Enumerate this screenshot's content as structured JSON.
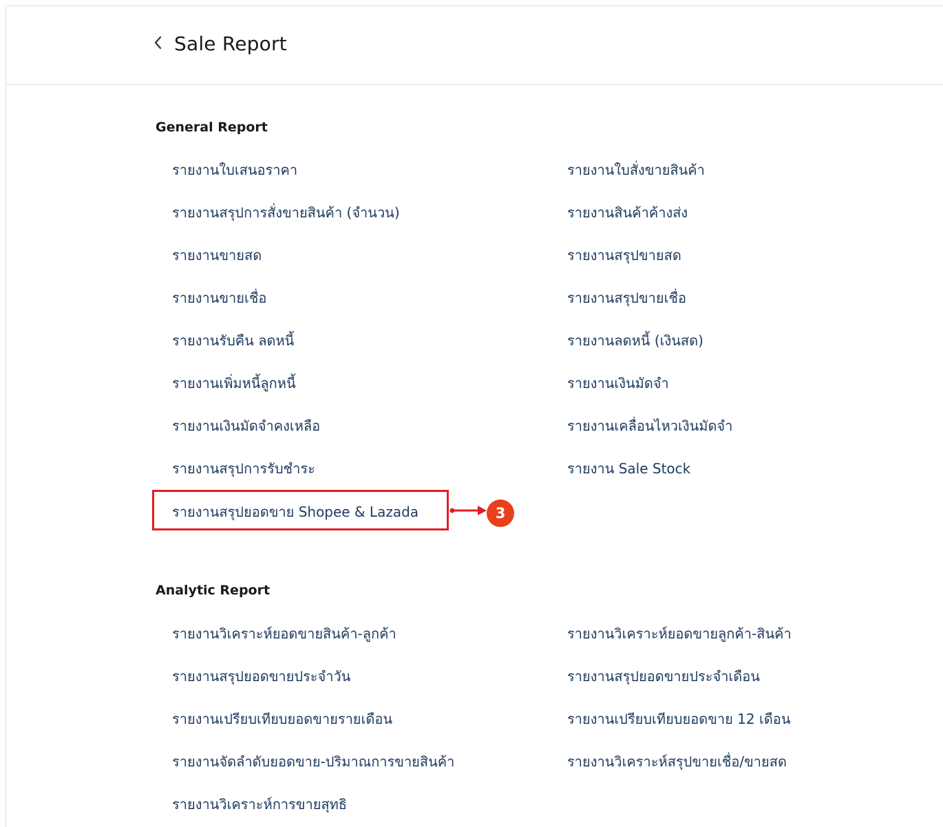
{
  "header": {
    "back_glyph": "chevron-left-icon",
    "title": "Sale Report"
  },
  "general": {
    "title": "General Report",
    "left": [
      "รายงานใบเสนอราคา",
      "รายงานสรุปการสั่งขายสินค้า (จำนวน)",
      "รายงานขายสด",
      "รายงานขายเชื่อ",
      "รายงานรับคืน ลดหนี้",
      "รายงานเพิ่มหนี้ลูกหนี้",
      "รายงานเงินมัดจำคงเหลือ",
      "รายงานสรุปการรับชำระ",
      "รายงานสรุปยอดขาย Shopee & Lazada"
    ],
    "right": [
      "รายงานใบสั่งขายสินค้า",
      "รายงานสินค้าค้างส่ง",
      "รายงานสรุปขายสด",
      "รายงานสรุปขายเชื่อ",
      "รายงานลดหนี้ (เงินสด)",
      "รายงานเงินมัดจำ",
      "รายงานเคลื่อนไหวเงินมัดจำ",
      "รายงาน Sale Stock"
    ]
  },
  "annotation": {
    "step_number": "3",
    "accent_color": "#e31e24",
    "badge_color": "#e8401c"
  },
  "analytic": {
    "title": "Analytic Report",
    "left": [
      "รายงานวิเคราะห์ยอดขายสินค้า-ลูกค้า",
      "รายงานสรุปยอดขายประจำวัน",
      "รายงานเปรียบเทียบยอดขายรายเดือน",
      "รายงานจัดลำดับยอดขาย-ปริมาณการขายสินค้า",
      "รายงานวิเคราะห์การขายสุทธิ"
    ],
    "right": [
      "รายงานวิเคราะห์ยอดขายลูกค้า-สินค้า",
      "รายงานสรุปยอดขายประจำเดือน",
      "รายงานเปรียบเทียบยอดขาย 12 เดือน",
      "รายงานวิเคราะห์สรุปขายเชื่อ/ขายสด"
    ]
  }
}
